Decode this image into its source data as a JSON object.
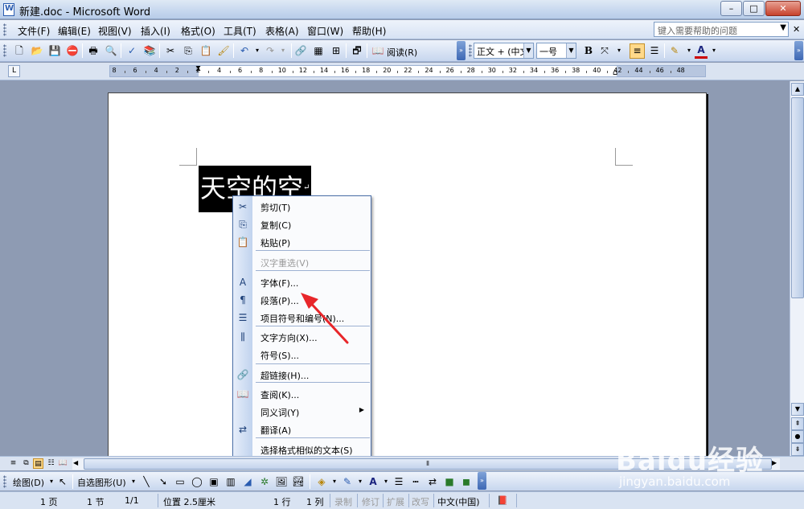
{
  "window": {
    "title": "新建.doc - Microsoft Word",
    "minimize": "–",
    "maximize": "□",
    "close": "✕"
  },
  "menubar": {
    "items": [
      "文件(F)",
      "编辑(E)",
      "视图(V)",
      "插入(I)",
      "格式(O)",
      "工具(T)",
      "表格(A)",
      "窗口(W)",
      "帮助(H)"
    ],
    "help_placeholder": "键入需要帮助的问题",
    "close_doc": "✕"
  },
  "toolbar": {
    "read_label": "阅读(R)",
    "style_value": "正文 + (中文",
    "size_value": "一号",
    "bold": "B",
    "font_color": "A"
  },
  "ruler": {
    "numbers": [
      "8",
      "6",
      "4",
      "2",
      "2",
      "4",
      "6",
      "8",
      "10",
      "12",
      "14",
      "16",
      "18",
      "20",
      "22",
      "24",
      "26",
      "28",
      "30",
      "32",
      "34",
      "36",
      "38",
      "40",
      "42",
      "44",
      "46",
      "48"
    ]
  },
  "vruler": {
    "numbers": [
      "4",
      "2",
      "2",
      "4",
      "6",
      "8",
      "10",
      "12",
      "14",
      "16",
      "18"
    ]
  },
  "document": {
    "selected_text": "天空的空"
  },
  "context_menu": {
    "items": [
      {
        "icon": "✂",
        "label": "剪切(T)",
        "enabled": true
      },
      {
        "icon": "⎘",
        "label": "复制(C)",
        "enabled": true
      },
      {
        "icon": "📋",
        "label": "粘贴(P)",
        "enabled": true
      },
      {
        "icon": "",
        "label": "汉字重选(V)",
        "enabled": false
      },
      {
        "icon": "A",
        "label": "字体(F)...",
        "enabled": true
      },
      {
        "icon": "¶",
        "label": "段落(P)...",
        "enabled": true
      },
      {
        "icon": "☰",
        "label": "项目符号和编号(N)...",
        "enabled": true
      },
      {
        "icon": "⫼",
        "label": "文字方向(X)...",
        "enabled": true
      },
      {
        "icon": "",
        "label": "符号(S)...",
        "enabled": true
      },
      {
        "icon": "🔗",
        "label": "超链接(H)...",
        "enabled": true
      },
      {
        "icon": "📖",
        "label": "查阅(K)...",
        "enabled": true
      },
      {
        "icon": "",
        "label": "同义词(Y)",
        "enabled": true,
        "submenu": true
      },
      {
        "icon": "⇄",
        "label": "翻译(A)",
        "enabled": true
      },
      {
        "icon": "",
        "label": "选择格式相似的文本(S)",
        "enabled": true
      }
    ]
  },
  "drawbar": {
    "draw_label": "绘图(D)",
    "autoshape_label": "自选图形(U)"
  },
  "statusbar": {
    "page": "1 页",
    "section": "1 节",
    "page_of": "1/1",
    "position": "位置 2.5厘米",
    "line": "1 行",
    "column": "1 列",
    "rec": "录制",
    "trk": "修订",
    "ext": "扩展",
    "ovr": "改写",
    "lang": "中文(中国)"
  },
  "watermark": {
    "brand": "Baidu经验",
    "url": "jingyan.baidu.com"
  },
  "colors": {
    "accent": "#2a5cb0",
    "arrow": "#e8262a"
  }
}
